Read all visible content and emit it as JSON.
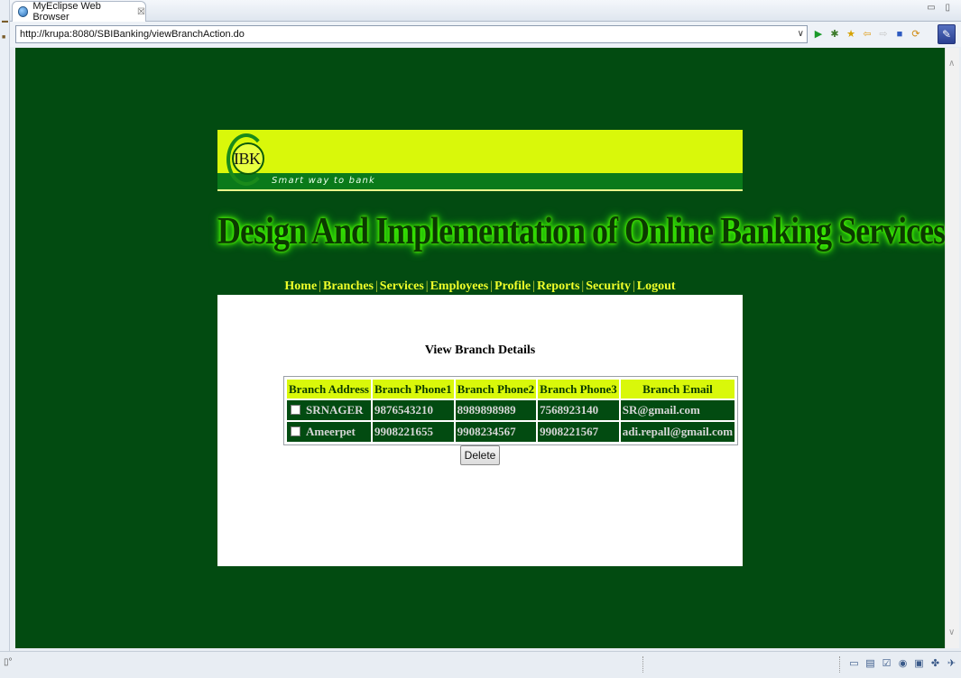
{
  "window": {
    "tab_title": "MyEclipse Web Browser",
    "tab_close": "☒",
    "window_controls": "▭ ▯"
  },
  "address_bar": {
    "url": "http://krupa:8080/SBIBanking/viewBranchAction.do",
    "dropdown": "∨"
  },
  "toolbar_icons": [
    "go-icon",
    "debug-icon",
    "favorites-icon",
    "back-icon",
    "forward-icon",
    "stop-icon",
    "refresh-icon"
  ],
  "page": {
    "logo": "IBK",
    "tagline": "Smart way to bank",
    "title": "Design And Implementation of  Online Banking Services",
    "nav": [
      {
        "label": "Home",
        "sep": ""
      },
      {
        "label": "Branches",
        "sep": "|"
      },
      {
        "label": "Services",
        "sep": "|"
      },
      {
        "label": "Employees",
        "sep": "|"
      },
      {
        "label": "Profile",
        "sep": "|"
      },
      {
        "label": "Reports",
        "sep": "|"
      },
      {
        "label": "Security",
        "sep": "|"
      },
      {
        "label": "Logout",
        "sep": "|"
      }
    ],
    "section_title": "View Branch Details",
    "table": {
      "headers": [
        "Branch Address",
        "Branch Phone1",
        "Branch Phone2",
        "Branch Phone3",
        "Branch Email"
      ],
      "rows": [
        [
          "SRNAGER",
          "9876543210",
          "8989898989",
          "7568923140",
          "SR@gmail.com"
        ],
        [
          "Ameerpet",
          "9908221655",
          "9908234567",
          "9908221567",
          "adi.repall@gmail.com"
        ]
      ]
    },
    "delete_label": "Delete"
  },
  "colors": {
    "page_bg": "#024b11",
    "banner_yellow": "#d9f80a",
    "nav_text": "#f0ff2a",
    "title_glow": "#3cff00"
  }
}
